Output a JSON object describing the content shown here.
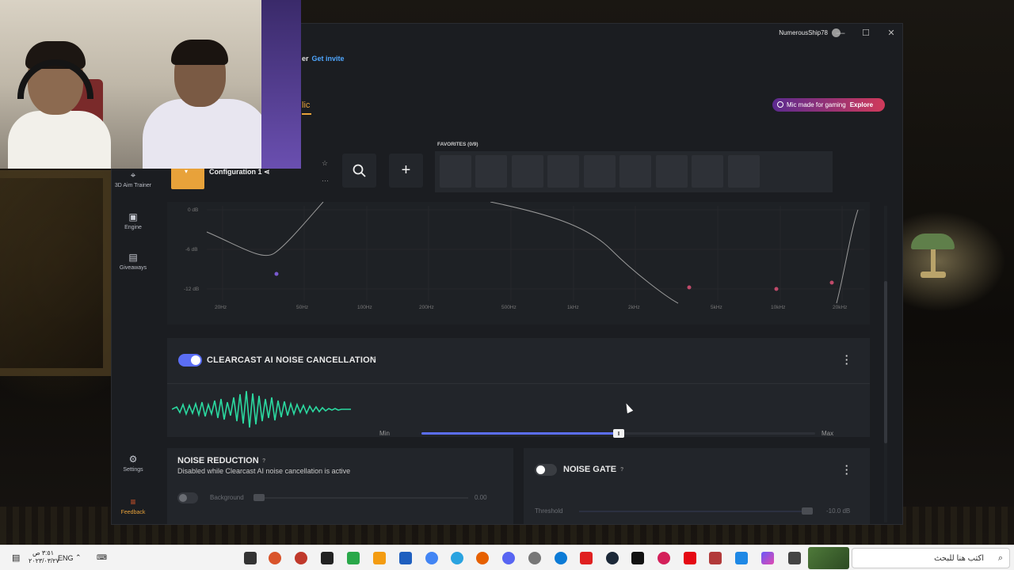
{
  "titlebar": {
    "username": "NumerousShip78",
    "minimize": "—",
    "maximize": "☐",
    "close": "✕"
  },
  "invite": {
    "prefix": "er",
    "link": "Get invite"
  },
  "tab_partial": "lic",
  "promo": {
    "text": "Mic made for gaming",
    "action": "Explore"
  },
  "sidebar": {
    "items": [
      {
        "label": "3D Aim Trainer",
        "icon": "aim-icon"
      },
      {
        "label": "Engine",
        "icon": "engine-icon"
      },
      {
        "label": "Giveaways",
        "icon": "gift-icon"
      },
      {
        "label": "Settings",
        "icon": "gear-icon"
      },
      {
        "label": "Feedback",
        "icon": "feedback-icon"
      }
    ]
  },
  "config": {
    "name": "Configuration 1"
  },
  "favorites": {
    "label": "FAVORITES (0/9)",
    "slots": 9
  },
  "eq": {
    "y_labels": [
      "0 dB",
      "-6 dB",
      "-12 dB"
    ],
    "x_labels": [
      "20Hz",
      "50Hz",
      "100Hz",
      "200Hz",
      "500Hz",
      "1kHz",
      "2kHz",
      "5kHz",
      "10kHz",
      "20kHz"
    ]
  },
  "clearcast": {
    "title": "CLEARCAST AI NOISE CANCELLATION",
    "help": "?",
    "enabled": true,
    "min_label": "Min",
    "max_label": "Max",
    "level_fraction": 0.5
  },
  "noise_reduction": {
    "title": "NOISE REDUCTION",
    "help": "?",
    "subtitle": "Disabled while Clearcast AI noise cancellation is active",
    "background_label": "Background",
    "value": "0.00",
    "enabled": false
  },
  "noise_gate": {
    "title": "NOISE GATE",
    "help": "?",
    "threshold_label": "Threshold",
    "value": "-10.0 dB",
    "enabled": false
  },
  "taskbar": {
    "time": "٣:٥١ ص",
    "date": "٢٠٢٣/٠٣/٢٧",
    "lang": "ENG",
    "search_placeholder": "اكتب هنا للبحث",
    "colors": {
      "accent": "#e8a23a",
      "toggle_on": "#5b6ef5",
      "link": "#4fa7ff"
    }
  }
}
